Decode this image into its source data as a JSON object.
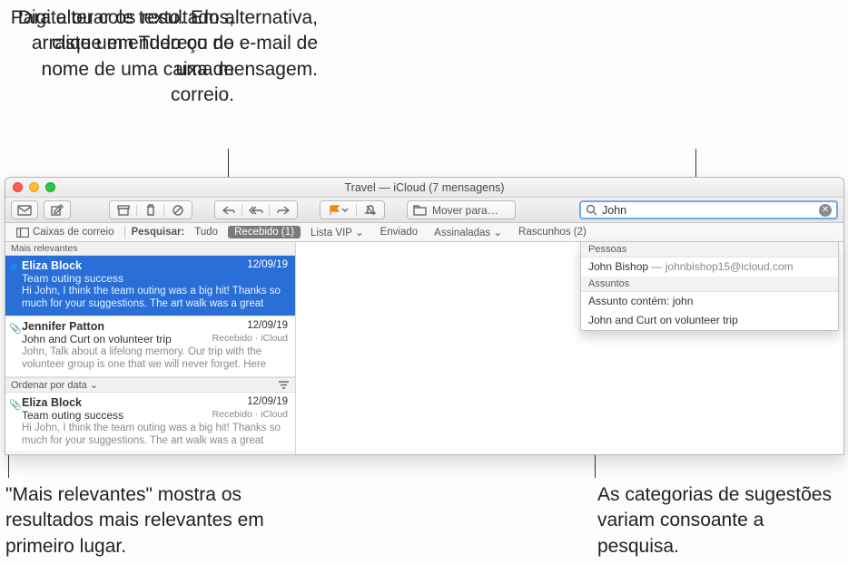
{
  "annotations": {
    "top_left": "Para alterar os resultados, clique em Tudo ou no nome de uma caixa de correio.",
    "top_right": "Digite ou cole texto. Em alternativa, arraste um endereço de e-mail de uma mensagem.",
    "bottom_left": "\"Mais relevantes\" mostra os resultados mais relevantes em primeiro lugar.",
    "bottom_right": "As categorias de sugestões variam consoante a pesquisa."
  },
  "window_title": "Travel  — iCloud (7 mensagens)",
  "toolbar": {
    "move_label": "Mover para…"
  },
  "search": {
    "value": "John"
  },
  "favbar": {
    "mailboxes": "Caixas de correio",
    "search_label": "Pesquisar:",
    "scopes": {
      "all": "Tudo",
      "inbox": "Recebido (1)",
      "vip": "Lista VIP",
      "sent": "Enviado",
      "flagged": "Assinaladas",
      "drafts": "Rascunhos (2)"
    }
  },
  "list": {
    "group_top": "Mais relevantes",
    "sort_label": "Ordenar por data",
    "messages": [
      {
        "sender": "Eliza Block",
        "date": "12/09/19",
        "subject": "Team outing success",
        "mailbox": "",
        "preview": "Hi John, I think the team outing was a big hit! Thanks so much for your suggestions. The art walk was a great ide…",
        "selected": true,
        "unread": true,
        "attachment": false
      },
      {
        "sender": "Jennifer Patton",
        "date": "12/09/19",
        "subject": "John and Curt on volunteer trip",
        "mailbox": "Recebido · iCloud",
        "preview": "John, Talk about a lifelong memory. Our trip with the volunteer group is one that we will never forget. Here ar…",
        "selected": false,
        "unread": false,
        "attachment": true
      },
      {
        "sender": "Eliza Block",
        "date": "12/09/19",
        "subject": "Team outing success",
        "mailbox": "Recebido · iCloud",
        "preview": "Hi John, I think the team outing was a big hit! Thanks so much for your suggestions. The art walk was a great ide…",
        "selected": false,
        "unread": false,
        "attachment": true
      }
    ]
  },
  "suggestions": {
    "people_hdr": "Pessoas",
    "person_name": "John Bishop",
    "person_email": "— johnbishop15@icloud.com",
    "subjects_hdr": "Assuntos",
    "subj1": "Assunto contém: john",
    "subj2": "John and Curt on volunteer trip"
  }
}
